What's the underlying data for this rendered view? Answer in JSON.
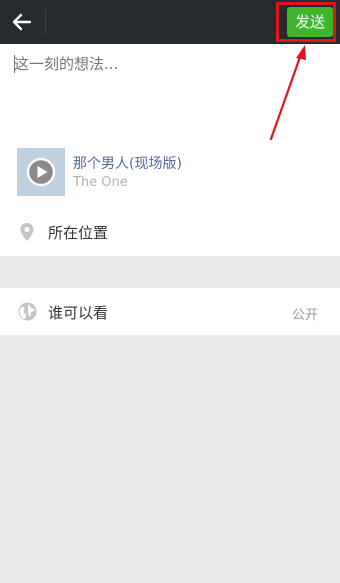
{
  "header": {
    "back_icon": "arrow-left-icon",
    "send_label": "发送"
  },
  "compose": {
    "placeholder": "这一刻的想法..."
  },
  "music": {
    "cover_icon": "play-icon",
    "title": "那个男人(现场版)",
    "artist": "The One"
  },
  "location": {
    "icon": "location-pin-icon",
    "label": "所在位置"
  },
  "privacy": {
    "icon": "globe-icon",
    "label": "谁可以看",
    "value": "公开"
  },
  "colors": {
    "topbar": "#272b2e",
    "send_button": "#3fb52a",
    "highlight": "#e0141c",
    "link_blue": "#576b95",
    "page_background": "#ebebeb"
  }
}
